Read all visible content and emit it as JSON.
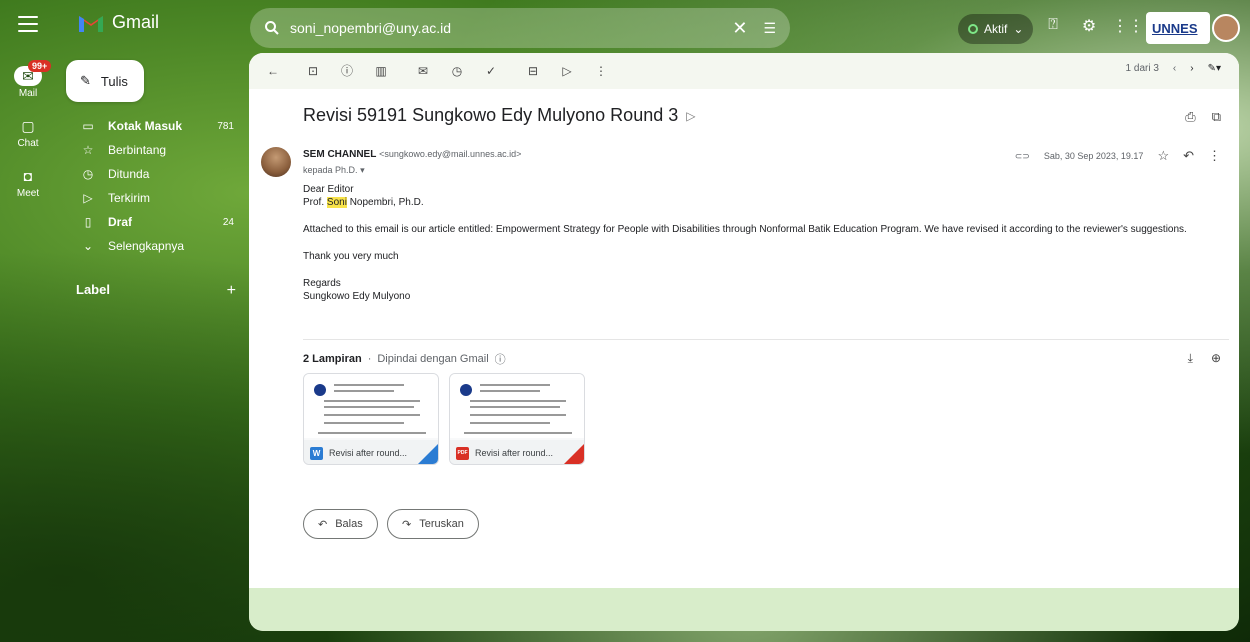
{
  "header": {
    "app_name": "Gmail",
    "search_value": "soni_nopembri@uny.ac.id",
    "status": "Aktif",
    "org_label": "UNNES"
  },
  "rail": {
    "mail_badge": "99+",
    "items": [
      {
        "label": "Mail",
        "icon": "mail-icon"
      },
      {
        "label": "Chat",
        "icon": "chat-icon"
      },
      {
        "label": "Meet",
        "icon": "meet-icon"
      }
    ]
  },
  "sidebar": {
    "compose_label": "Tulis",
    "items": [
      {
        "label": "Kotak Masuk",
        "count": "781",
        "icon": "inbox-icon",
        "bold": true
      },
      {
        "label": "Berbintang",
        "count": "",
        "icon": "star-icon",
        "bold": false
      },
      {
        "label": "Ditunda",
        "count": "",
        "icon": "clock-icon",
        "bold": false
      },
      {
        "label": "Terkirim",
        "count": "",
        "icon": "send-icon",
        "bold": false
      },
      {
        "label": "Draf",
        "count": "24",
        "icon": "draft-icon",
        "bold": true
      },
      {
        "label": "Selengkapnya",
        "count": "",
        "icon": "chevron-down-icon",
        "bold": false
      }
    ],
    "label_header": "Label"
  },
  "toolbar": {
    "pagination": "1 dari 3"
  },
  "email": {
    "subject": "Revisi 59191 Sungkowo Edy Mulyono Round 3",
    "sender_name": "SEM CHANNEL",
    "sender_email": "<sungkowo.edy@mail.unnes.ac.id>",
    "to_line": "kepada Ph.D.",
    "date": "Sab, 30 Sep 2023, 19.17",
    "body": {
      "greeting": "Dear Editor",
      "recipient_prefix": "Prof. ",
      "recipient_highlight": "Soni",
      "recipient_suffix": " Nopembri, Ph.D.",
      "paragraph": "Attached to this email is our article entitled: Empowerment Strategy for People with Disabilities through Nonformal Batik Education Program. We have revised it according to the reviewer's suggestions.",
      "thanks": "Thank you very much",
      "closing": "Regards",
      "signature": "Sungkowo Edy Mulyono"
    },
    "attachments_count": "2 Lampiran",
    "attachments_scan": "Dipindai dengan Gmail",
    "attachments": [
      {
        "name": "Revisi after round...",
        "type": "W",
        "color": "#2b7cd3",
        "corner": "#2b7cd3"
      },
      {
        "name": "Revisi after round...",
        "type": "PDF",
        "color": "#d93025",
        "corner": "#d93025"
      }
    ],
    "reply_label": "Balas",
    "forward_label": "Teruskan"
  },
  "colors": {
    "accent": "#f8e34a",
    "panel_bg": "#ffffff"
  }
}
